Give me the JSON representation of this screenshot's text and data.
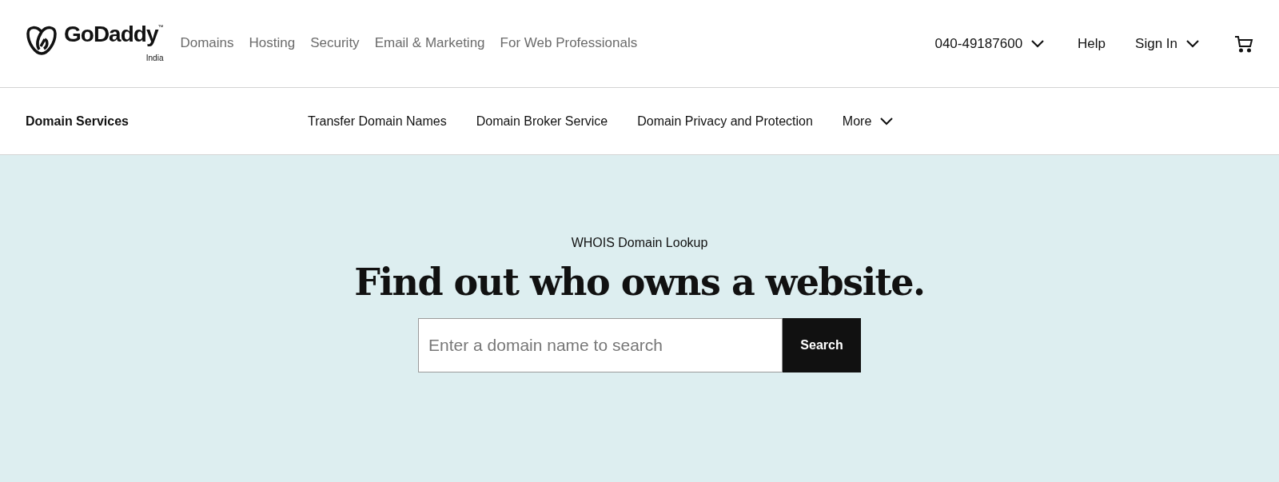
{
  "header": {
    "brand": "GoDaddy",
    "brand_mark": "™",
    "region": "India",
    "nav": [
      "Domains",
      "Hosting",
      "Security",
      "Email & Marketing",
      "For Web Professionals"
    ],
    "phone": "040-49187600",
    "help": "Help",
    "sign_in": "Sign In"
  },
  "subnav": {
    "title": "Domain Services",
    "links": [
      "Transfer Domain Names",
      "Domain Broker Service",
      "Domain Privacy and Protection"
    ],
    "more": "More"
  },
  "hero": {
    "eyebrow": "WHOIS Domain Lookup",
    "heading": "Find out who owns a website.",
    "search": {
      "placeholder": "Enter a domain name to search"
    },
    "button": "Search"
  }
}
